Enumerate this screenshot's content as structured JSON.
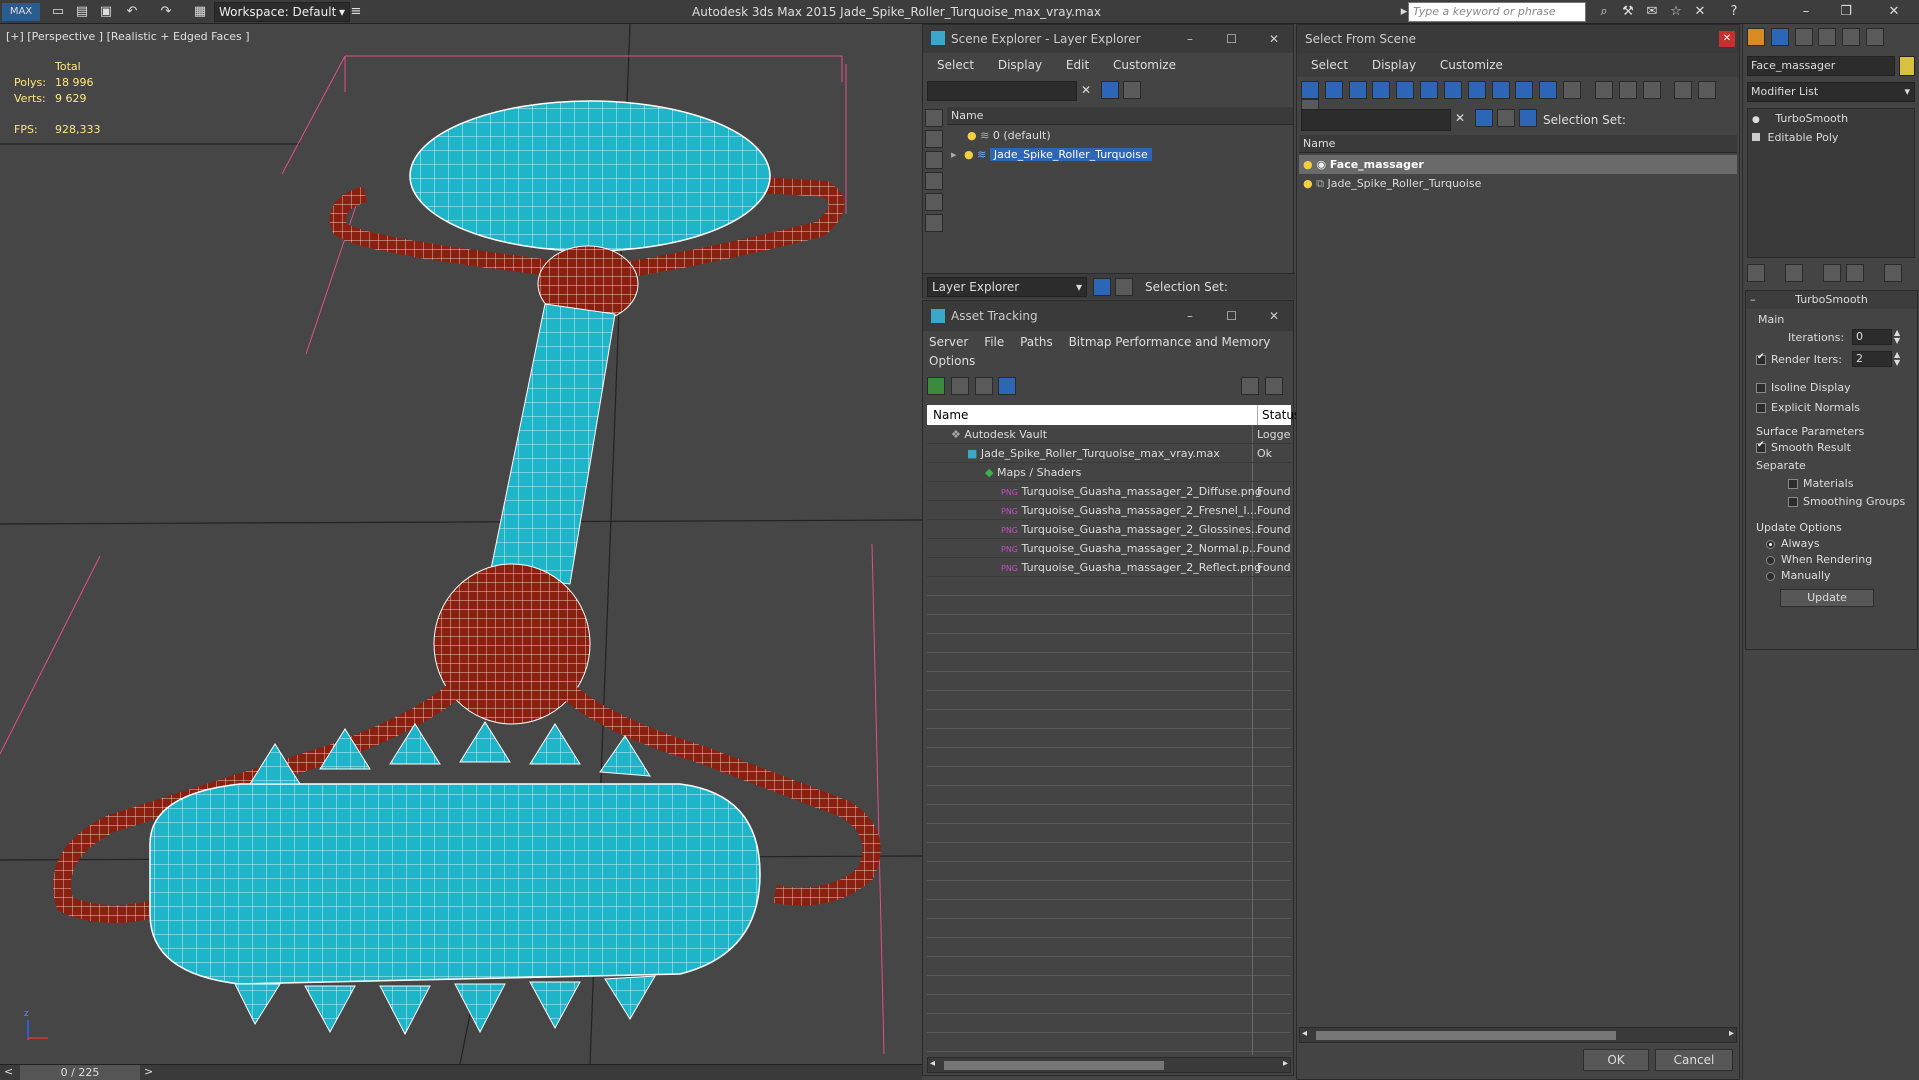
{
  "titlebar": {
    "workspace": "Workspace: Default",
    "app_title": "Autodesk 3ds Max  2015    Jade_Spike_Roller_Turquoise_max_vray.max",
    "search_placeholder": "Type a keyword or phrase"
  },
  "viewport": {
    "label": "[+] [Perspective ] [Realistic + Edged Faces ]",
    "stats": {
      "total_label": "Total",
      "polys_label": "Polys:",
      "polys_value": "18 996",
      "verts_label": "Verts:",
      "verts_value": "9 629",
      "fps_label": "FPS:",
      "fps_value": "928,333"
    },
    "timeline": {
      "frame": "0 / 225",
      "prev": "<",
      "next": ">"
    }
  },
  "scene_explorer": {
    "title": "Scene Explorer - Layer Explorer",
    "menu": [
      "Select",
      "Display",
      "Edit",
      "Customize"
    ],
    "col_name": "Name",
    "rows": [
      {
        "label": "0 (default)",
        "selected": false
      },
      {
        "label": "Jade_Spike_Roller_Turquoise",
        "selected": true
      }
    ],
    "footer_combo": "Layer Explorer",
    "selection_set_label": "Selection Set:"
  },
  "asset_tracking": {
    "title": "Asset Tracking",
    "menu": [
      "Server",
      "File",
      "Paths",
      "Bitmap Performance and Memory",
      "Options"
    ],
    "col_name": "Name",
    "col_status": "Status",
    "rows": [
      {
        "name": "Autodesk Vault",
        "status": "Logged",
        "indent": 0
      },
      {
        "name": "Jade_Spike_Roller_Turquoise_max_vray.max",
        "status": "Ok",
        "indent": 1
      },
      {
        "name": "Maps / Shaders",
        "status": "",
        "indent": 2
      },
      {
        "name": "Turquoise_Guasha_massager_2_Diffuse.png",
        "status": "Found",
        "indent": 3
      },
      {
        "name": "Turquoise_Guasha_massager_2_Fresnel_I...",
        "status": "Found",
        "indent": 3
      },
      {
        "name": "Turquoise_Guasha_massager_2_Glossines...",
        "status": "Found",
        "indent": 3
      },
      {
        "name": "Turquoise_Guasha_massager_2_Normal.p...",
        "status": "Found",
        "indent": 3
      },
      {
        "name": "Turquoise_Guasha_massager_2_Reflect.png",
        "status": "Found",
        "indent": 3
      }
    ]
  },
  "select_from_scene": {
    "title": "Select From Scene",
    "menu": [
      "Select",
      "Display",
      "Customize"
    ],
    "selection_set_label": "Selection Set:",
    "col_name": "Name",
    "rows": [
      {
        "label": "Face_massager",
        "selected": true
      },
      {
        "label": "Jade_Spike_Roller_Turquoise",
        "selected": false
      }
    ],
    "ok": "OK",
    "cancel": "Cancel"
  },
  "command_panel": {
    "object_name": "Face_massager",
    "modifier_list": "Modifier List",
    "stack": [
      "TurboSmooth",
      "Editable Poly"
    ],
    "rollout_title": "TurboSmooth",
    "main_label": "Main",
    "iterations_label": "Iterations:",
    "iterations_value": "0",
    "render_iters_label": "Render Iters:",
    "render_iters_value": "2",
    "isoline_label": "Isoline Display",
    "explicit_label": "Explicit Normals",
    "surface_label": "Surface Parameters",
    "smooth_label": "Smooth Result",
    "separate_label": "Separate",
    "materials_label": "Materials",
    "smoothing_groups_label": "Smoothing Groups",
    "update_options_label": "Update Options",
    "always_label": "Always",
    "when_rendering_label": "When Rendering",
    "manually_label": "Manually",
    "update_button": "Update"
  },
  "colors": {
    "turquoise": "#1fb5c9",
    "handle_red": "#8a2010",
    "wire": "#ffffff",
    "selection_blue": "#2d65b7"
  }
}
